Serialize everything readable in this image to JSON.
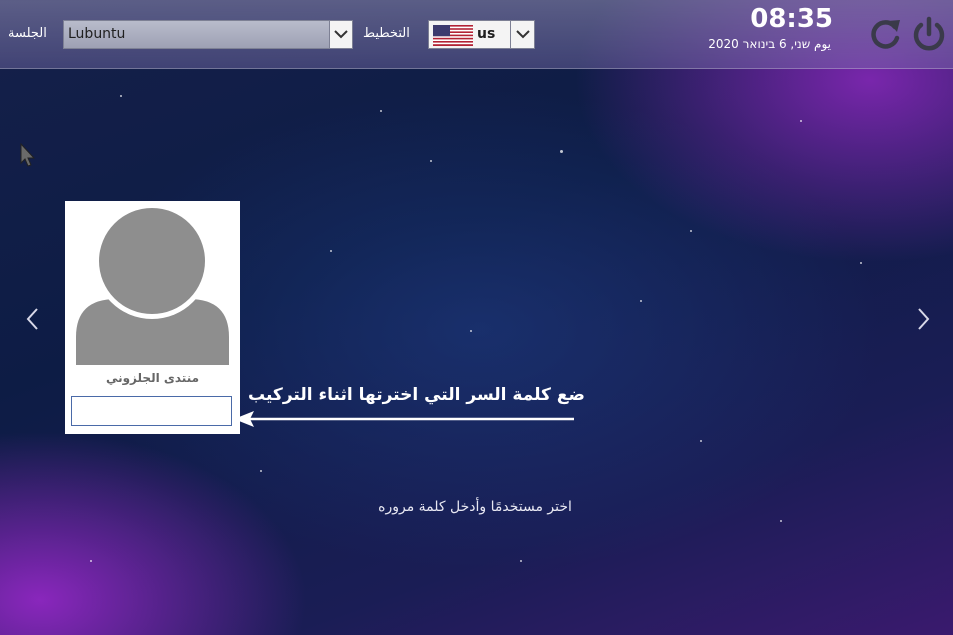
{
  "topbar": {
    "session_label": "الجلسة",
    "session_value": "Lubuntu",
    "layout_label": "التخطيط",
    "layout_value": "us",
    "clock": "08:35",
    "date": "يوم שני, 6 בינואר 2020"
  },
  "icons": {
    "restart": "restart-icon",
    "power": "power-icon",
    "flag": "us-flag-icon",
    "chevron": "chevron-down-icon",
    "prev": "chevron-left-icon",
    "next": "chevron-right-icon",
    "cursor": "mouse-cursor-icon"
  },
  "user_card": {
    "name": "منتدى الجلزوني",
    "password_value": ""
  },
  "annotation": {
    "text": "ضع كلمة السر التي اخترتها اثناء التركيب"
  },
  "hint": "اختر مستخدمًا وأدخل كلمة مروره",
  "colors": {
    "background_dark": "#0d1c45",
    "accent_purple": "#8c28be",
    "field_border": "#4a6aa8"
  }
}
